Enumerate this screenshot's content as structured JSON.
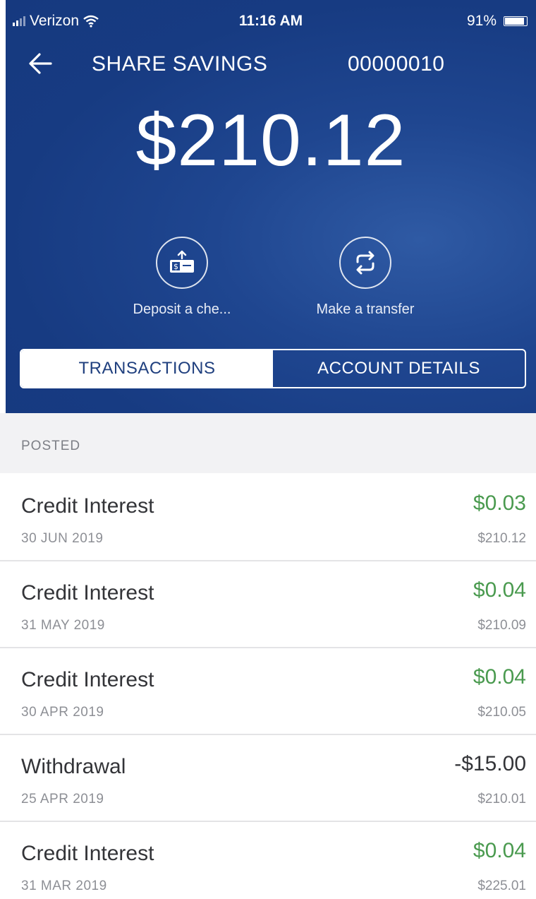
{
  "status_bar": {
    "carrier": "Verizon",
    "time": "11:16 AM",
    "battery_percent": "91%",
    "battery_level": 0.91
  },
  "header": {
    "title": "SHARE SAVINGS",
    "account_number": "00000010",
    "balance": "$210.12",
    "background_color": "#1f4690"
  },
  "actions": [
    {
      "label": "Deposit a che...",
      "icon": "deposit-check-icon"
    },
    {
      "label": "Make a transfer",
      "icon": "transfer-arrows-icon"
    }
  ],
  "tabs": [
    {
      "label": "TRANSACTIONS",
      "active": true
    },
    {
      "label": "ACCOUNT DETAILS",
      "active": false
    }
  ],
  "section": {
    "label": "POSTED"
  },
  "transactions": [
    {
      "name": "Credit Interest",
      "date": "30 JUN 2019",
      "amount": "$0.03",
      "running_balance": "$210.12"
    },
    {
      "name": "Credit Interest",
      "date": "31 MAY 2019",
      "amount": "$0.04",
      "running_balance": "$210.09"
    },
    {
      "name": "Credit Interest",
      "date": "30 APR 2019",
      "amount": "$0.04",
      "running_balance": "$210.05"
    },
    {
      "name": "Withdrawal",
      "date": "25 APR 2019",
      "amount": "-$15.00",
      "running_balance": "$210.01"
    },
    {
      "name": "Credit Interest",
      "date": "31 MAR 2019",
      "amount": "$0.04",
      "running_balance": "$225.01"
    }
  ],
  "colors": {
    "credit_amount": "#4a9a4f",
    "debit_amount": "#333438"
  }
}
